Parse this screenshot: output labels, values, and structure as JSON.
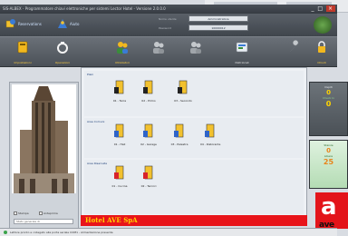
{
  "window": {
    "title": "SIS-ALBEX - Programmatore chiavi elettroniche per sistemi Lector Hotel - Versione 2.0.0.0",
    "controls": [
      "_",
      "□",
      "×"
    ]
  },
  "header": {
    "reservations_label": "Reservations",
    "help_label": "Aiuto",
    "user_field_label": "Nome utente",
    "user_value": "Amministratore",
    "password_field_label": "Password",
    "password_value": "10000012"
  },
  "toolbar": {
    "items": [
      {
        "label": "Impostazioni",
        "icon": "settings-book-icon",
        "color": "yellow"
      },
      {
        "label": "Operazioni",
        "icon": "key-ring-icon",
        "color": "yellow"
      },
      {
        "label": "Utilizzatori",
        "icon": "users-icon",
        "color": "yellow"
      },
      {
        "label": "",
        "icon": "users-gray-icon",
        "color": "gray"
      },
      {
        "label": "",
        "icon": "users-gray-icon",
        "color": "gray"
      },
      {
        "label": "Dati locali",
        "icon": "database-icon",
        "color": "white"
      },
      {
        "label": "",
        "icon": "wrench-icon",
        "color": "gray"
      },
      {
        "label": "Chiudi",
        "icon": "lock-icon",
        "color": "yellow"
      }
    ]
  },
  "left_panel": {
    "check_label_1": "Stampa",
    "check_label_2": "Anteprima",
    "field_label": "Stato generale di"
  },
  "main": {
    "sections": [
      {
        "title": "Piani",
        "items": [
          {
            "label": "01 - Terra"
          },
          {
            "label": "02 - Primo"
          },
          {
            "label": "03 - Secondo"
          }
        ]
      },
      {
        "title": "Aree Comuni",
        "items": [
          {
            "label": "01 - Hall"
          },
          {
            "label": "02 - Garage"
          },
          {
            "label": "03 - Palestra"
          },
          {
            "label": "04 - Ristorante"
          }
        ]
      },
      {
        "title": "Aree Riservate",
        "items": [
          {
            "label": "01 - Cucina"
          },
          {
            "label": "02 - Tecnici"
          }
        ]
      }
    ],
    "banner": "Hotel AVE SpA"
  },
  "right_panel": {
    "card1": {
      "title": "Ospiti",
      "value": "0",
      "sub": "Check In",
      "sub_value": "0"
    },
    "card2": {
      "title": "Stanze",
      "value": "0",
      "sub": "Libere",
      "sub_value": "25"
    }
  },
  "status": "Lettore pronto e collegato alla porta seriale COM1 - Alimentazione presente",
  "brand": {
    "logo_letter": "a",
    "logo_text": "ave"
  }
}
